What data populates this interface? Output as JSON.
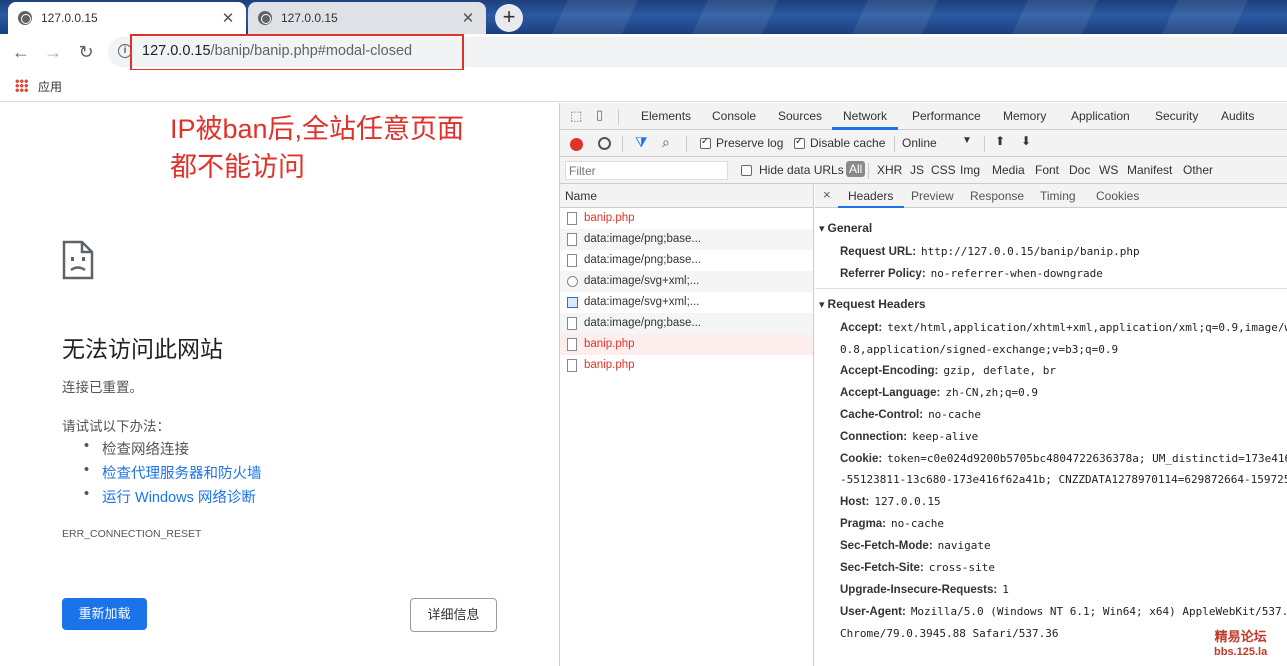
{
  "browser": {
    "tabs": [
      {
        "title": "127.0.0.15",
        "close": "✕"
      },
      {
        "title": "127.0.0.15",
        "close": "✕"
      }
    ],
    "new_tab": "+",
    "nav": {
      "back": "←",
      "forward": "→",
      "reload": "↻",
      "info": "i"
    },
    "url": {
      "host": "127.0.0.15",
      "path": "/banip/banip.php#modal-closed"
    },
    "bookmarks": {
      "apps_label": "应用"
    }
  },
  "annotation": {
    "line1": "IP被ban后,全站任意页面",
    "line2": "都不能访问",
    "color": "#e0322b"
  },
  "error_page": {
    "title": "无法访问此网站",
    "reset": "连接已重置。",
    "try_label": "请试试以下办法：",
    "suggestions": [
      "检查网络连接",
      "检查代理服务器和防火墙",
      "运行 Windows 网络诊断"
    ],
    "code": "ERR_CONNECTION_RESET",
    "reload_button": "重新加载",
    "details_button": "详细信息"
  },
  "devtools": {
    "tabs": [
      "Elements",
      "Console",
      "Sources",
      "Network",
      "Performance",
      "Memory",
      "Application",
      "Security",
      "Audits"
    ],
    "active_tab": "Network",
    "toolbar": {
      "preserve_log": "Preserve log",
      "disable_cache": "Disable cache",
      "throttle": "Online"
    },
    "filter": {
      "placeholder": "Filter",
      "hide_data_urls": "Hide data URLs",
      "types": [
        "All",
        "XHR",
        "JS",
        "CSS",
        "Img",
        "Media",
        "Font",
        "Doc",
        "WS",
        "Manifest",
        "Other"
      ]
    },
    "list_header": "Name",
    "requests": [
      {
        "name": "banip.php",
        "error": true
      },
      {
        "name": "data:image/png;base...",
        "error": false
      },
      {
        "name": "data:image/png;base...",
        "error": false
      },
      {
        "name": "data:image/svg+xml;...",
        "error": false
      },
      {
        "name": "data:image/svg+xml;...",
        "error": false
      },
      {
        "name": "data:image/png;base...",
        "error": false
      },
      {
        "name": "banip.php",
        "error": true
      },
      {
        "name": "banip.php",
        "error": true
      }
    ],
    "detail_tabs": [
      "Headers",
      "Preview",
      "Response",
      "Timing",
      "Cookies"
    ],
    "detail_close": "×",
    "general": {
      "title": "General",
      "rows": [
        {
          "k": "Request URL:",
          "v": "http://127.0.0.15/banip/banip.php"
        },
        {
          "k": "Referrer Policy:",
          "v": "no-referrer-when-downgrade"
        }
      ]
    },
    "request_headers": {
      "title": "Request Headers",
      "accept": {
        "k": "Accept:",
        "v": "text/html,application/xhtml+xml,application/xml;q=0.9,image/w",
        "cont": "0.8,application/signed-exchange;v=b3;q=0.9"
      },
      "accept_encoding": {
        "k": "Accept-Encoding:",
        "v": "gzip, deflate, br"
      },
      "accept_language": {
        "k": "Accept-Language:",
        "v": "zh-CN,zh;q=0.9"
      },
      "cache_control": {
        "k": "Cache-Control:",
        "v": "no-cache"
      },
      "connection": {
        "k": "Connection:",
        "v": "keep-alive"
      },
      "cookie": {
        "k": "Cookie:",
        "v": "token=c0e024d9200b5705bc4804722636378a; UM_distinctid=173e416",
        "cont": "-55123811-13c680-173e416f62a41b; CNZZDATA1278970114=629872664-1597251"
      },
      "host": {
        "k": "Host:",
        "v": "127.0.0.15"
      },
      "pragma": {
        "k": "Pragma:",
        "v": "no-cache"
      },
      "sec_fetch_mode": {
        "k": "Sec-Fetch-Mode:",
        "v": "navigate"
      },
      "sec_fetch_site": {
        "k": "Sec-Fetch-Site:",
        "v": "cross-site"
      },
      "upgrade_insecure": {
        "k": "Upgrade-Insecure-Requests:",
        "v": "1"
      },
      "user_agent": {
        "k": "User-Agent:",
        "v": "Mozilla/5.0 (Windows NT 6.1; Win64; x64) AppleWebKit/537.",
        "cont": "Chrome/79.0.3945.88 Safari/537.36"
      }
    }
  },
  "watermark": {
    "line1": "精易论坛",
    "line2": "bbs.125.la"
  }
}
